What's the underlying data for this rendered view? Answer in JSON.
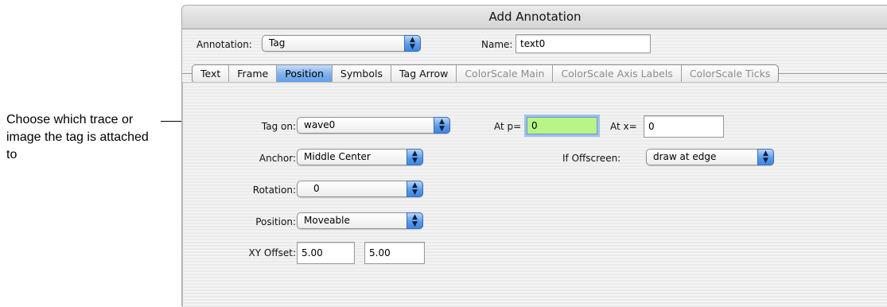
{
  "callout": {
    "text": "Choose which trace or image the tag is attached to"
  },
  "window": {
    "title": "Add Annotation"
  },
  "header": {
    "annotation_label": "Annotation:",
    "annotation_value": "Tag",
    "name_label": "Name:",
    "name_value": "text0"
  },
  "tabs": [
    {
      "label": "Text",
      "state": "normal"
    },
    {
      "label": "Frame",
      "state": "normal"
    },
    {
      "label": "Position",
      "state": "active"
    },
    {
      "label": "Symbols",
      "state": "normal"
    },
    {
      "label": "Tag Arrow",
      "state": "normal"
    },
    {
      "label": "ColorScale Main",
      "state": "disabled"
    },
    {
      "label": "ColorScale Axis Labels",
      "state": "disabled"
    },
    {
      "label": "ColorScale Ticks",
      "state": "disabled"
    }
  ],
  "position_tab": {
    "tag_on_label": "Tag on:",
    "tag_on_value": "wave0",
    "anchor_label": "Anchor:",
    "anchor_value": "Middle Center",
    "rotation_label": "Rotation:",
    "rotation_value": "0",
    "position_label": "Position:",
    "position_value": "Moveable",
    "xy_offset_label": "XY Offset:",
    "xy_offset_x": "5.00",
    "xy_offset_y": "5.00",
    "at_p_label": "At p=",
    "at_p_value": "0",
    "at_x_label": "At x=",
    "at_x_value": "0",
    "if_offscreen_label": "If Offscreen:",
    "if_offscreen_value": "draw at edge"
  },
  "colors": {
    "active_tab": "#6aa6ea",
    "focused_field_bg": "#b9f487",
    "focus_ring": "#9dc1ea"
  },
  "icons": {
    "popup_arrows": "up-down-arrows-icon"
  }
}
